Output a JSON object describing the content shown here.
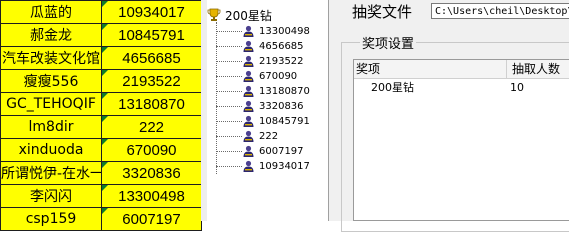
{
  "sheet": {
    "rows": [
      {
        "name": "瓜蓝的",
        "value": "10934017"
      },
      {
        "name": "郝金龙",
        "value": "10845791"
      },
      {
        "name": "汽车改装文化馆",
        "value": "4656685"
      },
      {
        "name": "瘦瘦556",
        "value": "2193522"
      },
      {
        "name": "GC_TEHOQIF",
        "value": "13180870"
      },
      {
        "name": "lm8dir",
        "value": "222"
      },
      {
        "name": "xinduoda",
        "value": "670090"
      },
      {
        "name": "所谓悦伊-在水一方",
        "value": "3320836"
      },
      {
        "name": "李闪闪",
        "value": "13300498"
      },
      {
        "name": "csp159",
        "value": "6007197"
      }
    ]
  },
  "tree": {
    "root_label": "200星钻",
    "root_icon": "trophy-icon",
    "leaf_icon": "person-icon",
    "leaves": [
      "13300498",
      "4656685",
      "2193522",
      "670090",
      "13180870",
      "3320836",
      "10845791",
      "222",
      "6007197",
      "10934017"
    ]
  },
  "settings": {
    "file_label": "抽奖文件",
    "file_path": "C:\\Users\\cheil\\Desktop\\",
    "group_title": "奖项设置",
    "list_headers": [
      "奖项",
      "抽取人数"
    ],
    "list_rows": [
      {
        "prize": "200星钻",
        "count": "10"
      }
    ]
  },
  "colors": {
    "cell_fill": "#ffff00",
    "comment_flag": "#0e7c2a",
    "panel_bg": "#f0f0f0"
  }
}
